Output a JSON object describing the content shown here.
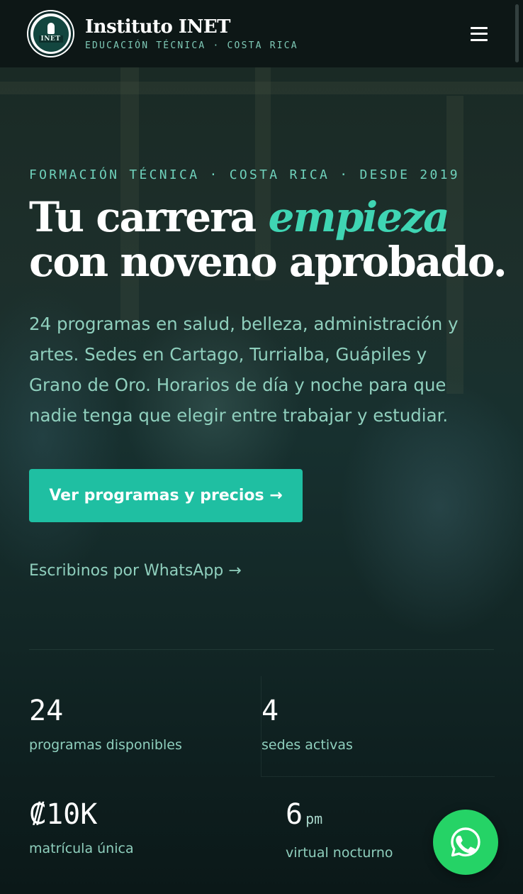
{
  "header": {
    "brand_name": "Instituto INET",
    "brand_sub": "EDUCACIÓN TÉCNICA · COSTA RICA",
    "logo_text": "INET"
  },
  "hero": {
    "eyebrow": "FORMACIÓN TÉCNICA · COSTA RICA · DESDE 2019",
    "headline_part1": "Tu carrera ",
    "headline_accent": "empieza",
    "headline_part2": "con noveno aprobado.",
    "lead": "24 programas en salud, belleza, administración y artes. Sedes en Cartago, Turrialba, Guápiles y Grano de Oro. Horarios de día y noche para que nadie tenga que elegir entre trabajar y estudiar.",
    "cta_label": "Ver programas y precios →",
    "whatsapp_link": "Escribinos por WhatsApp →"
  },
  "stats": [
    {
      "value": "24",
      "unit": "",
      "label": "programas disponibles"
    },
    {
      "value": "4",
      "unit": "",
      "label": "sedes activas"
    },
    {
      "value": "₡10K",
      "unit": "",
      "label": "matrícula única"
    },
    {
      "value": "6",
      "unit": "pm",
      "label": "virtual nocturno"
    }
  ],
  "icons": {
    "menu": "hamburger-menu-icon",
    "whatsapp": "whatsapp-icon"
  },
  "colors": {
    "accent": "#3fd5b3",
    "cta": "#1fbfa2",
    "whatsapp": "#25d366"
  }
}
